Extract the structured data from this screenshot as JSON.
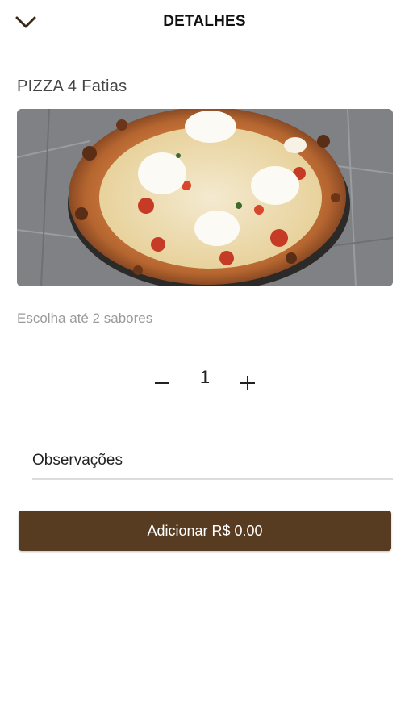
{
  "header": {
    "title": "DETALHES",
    "back_icon": "chevron-down-icon"
  },
  "product": {
    "name": "PIZZA 4 Fatias",
    "image_subject": "pizza"
  },
  "flavors": {
    "hint": "Escolha até 2 sabores"
  },
  "quantity": {
    "value": "1",
    "decrement_icon": "minus-icon",
    "increment_icon": "plus-icon"
  },
  "observations": {
    "placeholder": "Observações",
    "value": ""
  },
  "add_button": {
    "label": "Adicionar",
    "price": "R$ 0.00"
  },
  "colors": {
    "accent": "#573c22",
    "divider": "#e2e2e2",
    "hint_text": "#9a9a9a"
  }
}
